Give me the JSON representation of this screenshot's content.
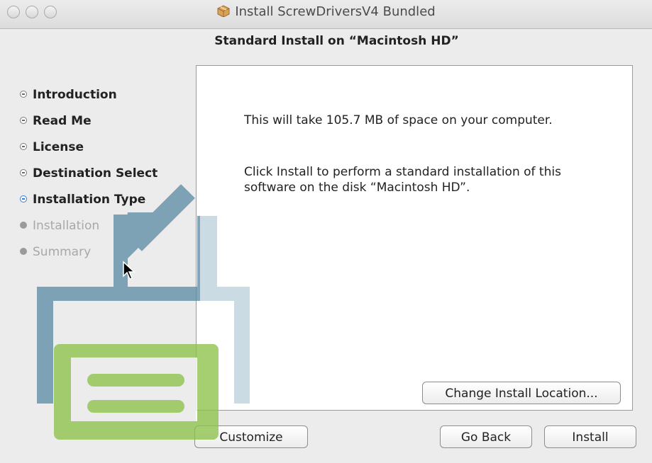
{
  "window": {
    "title": "Install ScrewDriversV4 Bundled"
  },
  "header": {
    "title": "Standard Install on “Macintosh HD”"
  },
  "sidebar": {
    "steps": [
      {
        "label": "Introduction",
        "state": "done"
      },
      {
        "label": "Read Me",
        "state": "done"
      },
      {
        "label": "License",
        "state": "done"
      },
      {
        "label": "Destination Select",
        "state": "done"
      },
      {
        "label": "Installation Type",
        "state": "active"
      },
      {
        "label": "Installation",
        "state": "future"
      },
      {
        "label": "Summary",
        "state": "future"
      }
    ]
  },
  "main": {
    "space_text": "This will take 105.7 MB of space on your computer.",
    "info_text": "Click Install to perform a standard installation of this software on the disk “Macintosh HD”.",
    "change_location_label": "Change Install Location..."
  },
  "footer": {
    "customize_label": "Customize",
    "go_back_label": "Go Back",
    "install_label": "Install"
  },
  "colors": {
    "active_bullet": "#2f7fd5",
    "watermark_blue": "#5f8ea6",
    "watermark_green": "#8cc24a"
  }
}
